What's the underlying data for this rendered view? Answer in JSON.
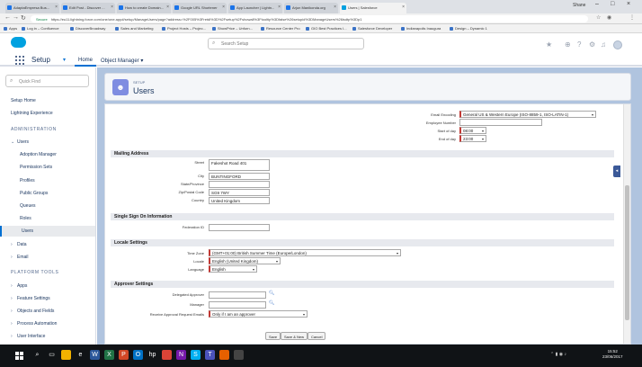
{
  "browser": {
    "tabs": [
      {
        "label": "AdaptaEmpresa Bus...",
        "active": false
      },
      {
        "label": "Edit Post - Discover ...",
        "active": false
      },
      {
        "label": "How to create Domain...",
        "active": false
      },
      {
        "label": "Google URL Shortener",
        "active": false
      },
      {
        "label": "App Launcher | Lightn...",
        "active": false
      },
      {
        "label": "Arjun Manikonda.org",
        "active": false
      },
      {
        "label": "Users | Salesforce",
        "active": true
      }
    ],
    "user_chip": "Shane",
    "url_secure_label": "Secure",
    "url": "https://eu11.lightning.force.com/one/one.app#/setup/ManageUsers/page?address=%2F005%3Fretdl%3D%2Fsetup%2Fshowall%3Ftooltip%3Dfalse%26setupid%3DManageUsers%26isdtp%3Dp1",
    "bookmarks": [
      "Apps",
      "Log in – Confluence",
      "DiscoverBroadway",
      "Sales and Marketing",
      "Project Hosts – Projec...",
      "ShowPrice – Unfurn...",
      "Resource Center Pro",
      "GIO Best Practices I...",
      "Salesforce Developer",
      "Indianapolis Inaugura",
      "Design – Dynamic 1"
    ]
  },
  "header": {
    "search_placeholder": "Search Setup",
    "app_name": "Setup",
    "nav_home": "Home",
    "nav_object_manager": "Object Manager"
  },
  "sidebar": {
    "quick_find_placeholder": "Quick Find",
    "items": [
      {
        "label": "Setup Home",
        "type": "top"
      },
      {
        "label": "Lightning Experience",
        "type": "top"
      },
      {
        "label": "ADMINISTRATION",
        "type": "head"
      },
      {
        "label": "Users",
        "type": "group"
      },
      {
        "label": "Adoption Manager",
        "type": "sub"
      },
      {
        "label": "Permission Sets",
        "type": "sub"
      },
      {
        "label": "Profiles",
        "type": "sub"
      },
      {
        "label": "Public Groups",
        "type": "sub"
      },
      {
        "label": "Queues",
        "type": "sub"
      },
      {
        "label": "Roles",
        "type": "sub"
      },
      {
        "label": "Users",
        "type": "sub-active"
      },
      {
        "label": "Data",
        "type": "group"
      },
      {
        "label": "Email",
        "type": "group"
      },
      {
        "label": "PLATFORM TOOLS",
        "type": "head"
      },
      {
        "label": "Apps",
        "type": "group"
      },
      {
        "label": "Feature Settings",
        "type": "group"
      },
      {
        "label": "Objects and Fields",
        "type": "group"
      },
      {
        "label": "Process Automation",
        "type": "group"
      },
      {
        "label": "User Interface",
        "type": "group"
      }
    ]
  },
  "page": {
    "breadcrumb": "SETUP",
    "title": "Users"
  },
  "form": {
    "top_fields": {
      "email_encoding_label": "Email Encoding",
      "email_encoding_value": "General US & Western Europe (ISO-8859-1, ISO-LATIN-1)",
      "employee_number_label": "Employee Number",
      "employee_number_value": "",
      "start_of_day_label": "Start of day",
      "start_of_day_value": "08:00",
      "end_of_day_label": "End of day",
      "end_of_day_value": "23:00"
    },
    "mailing": {
      "title": "Mailing Address",
      "street_label": "Street",
      "street_value": "Fakeshot Road 401",
      "city_label": "City",
      "city_value": "BUNTINGFORD",
      "state_label": "State/Province",
      "state_value": "",
      "zip_label": "Zip/Postal Code",
      "zip_value": "SG9 7WY",
      "country_label": "Country",
      "country_value": "United Kingdom"
    },
    "sso": {
      "title": "Single Sign On Information",
      "federation_label": "Federation ID",
      "federation_value": ""
    },
    "locale": {
      "title": "Locale Settings",
      "timezone_label": "Time Zone",
      "timezone_value": "(GMT+01:00) British Summer Time (Europe/London)",
      "locale_label": "Locale",
      "locale_value": "English (United Kingdom)",
      "language_label": "Language",
      "language_value": "English"
    },
    "approver": {
      "title": "Approver Settings",
      "delegated_label": "Delegated Approver",
      "delegated_value": "",
      "manager_label": "Manager",
      "manager_value": "",
      "receive_label": "Receive Approval Request Emails",
      "receive_value": "Only if I am an approver"
    },
    "buttons": {
      "save": "Save",
      "save_new": "Save & New",
      "cancel": "Cancel"
    }
  },
  "taskbar": {
    "time": "15:52",
    "date": "23/06/2017"
  },
  "colors": {
    "brand": "#00a1e0",
    "accent": "#0070d2",
    "required": "#c23934",
    "main_bg": "#b0c4df"
  }
}
